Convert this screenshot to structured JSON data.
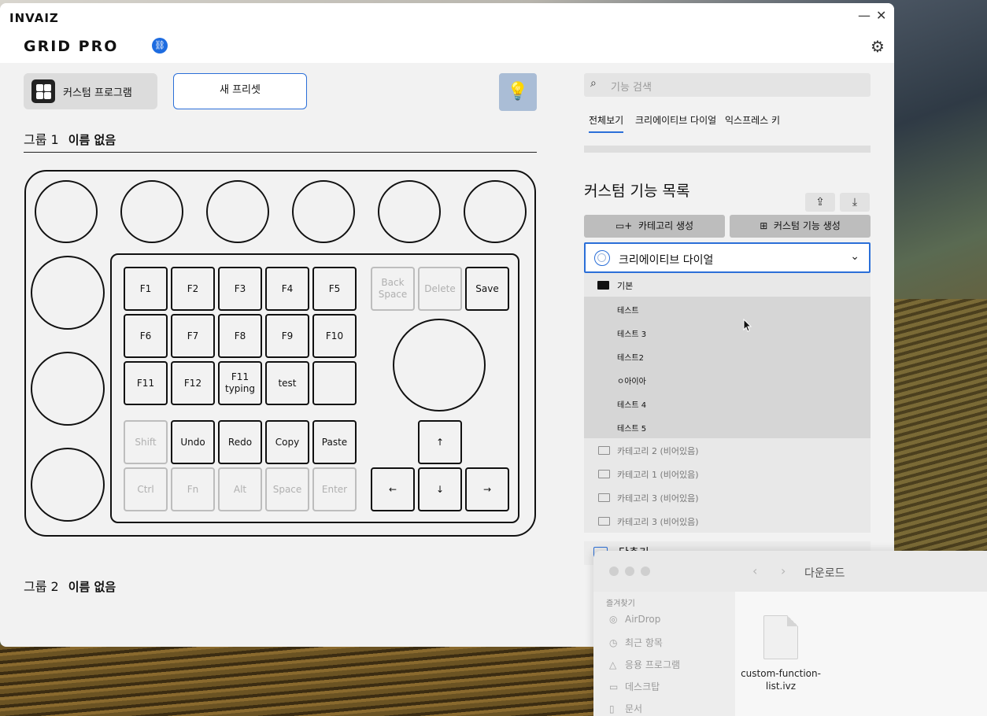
{
  "app": {
    "brand": "INVAIZ",
    "product": "GRID PRO",
    "minimize": "—",
    "close": "✕",
    "custom_program_label": "커스텀 프로그램",
    "new_preset_label": "새 프리셋",
    "group1": {
      "title": "그룹 1",
      "name": "이름 없음"
    },
    "group2": {
      "title": "그룹 2",
      "name": "이름 없음"
    }
  },
  "device": {
    "keys_row1": [
      "F1",
      "F2",
      "F3",
      "F4",
      "F5"
    ],
    "keys_row2": [
      "F6",
      "F7",
      "F8",
      "F9",
      "F10"
    ],
    "keys_row3": [
      "F11",
      "F12",
      "F11\ntyping",
      "test",
      ""
    ],
    "keys_row4": [
      "Shift",
      "Undo",
      "Redo",
      "Copy",
      "Paste"
    ],
    "keys_row5": [
      "Ctrl",
      "Fn",
      "Alt",
      "Space",
      "Enter"
    ],
    "top_right_keys": [
      "Back\nSpace",
      "Delete",
      "Save"
    ],
    "arrow_up": "↑",
    "arrows_bottom": [
      "←",
      "↓",
      "→"
    ]
  },
  "panel": {
    "search_placeholder": "기능 검색",
    "tabs": [
      "전체보기",
      "크리에이티브 다이얼",
      "익스프레스 키"
    ],
    "section_title": "커스텀 기능 목록",
    "create_category": "카테고리 생성",
    "create_function": "커스텀 기능 생성",
    "category_selected": "크리에이티브 다이얼",
    "folder_basic": "기본",
    "functions": [
      "테스트",
      "테스트 3",
      "테스트2",
      "ㅇ아이아",
      "테스트 4",
      "테스트 5"
    ],
    "empty_categories": [
      "카테고리 2 (비어있음)",
      "카테고리 1 (비어있음)",
      "카테고리 3 (비어있음)",
      "카테고리 3 (비어있음)"
    ],
    "next_category": "단축키"
  },
  "finder": {
    "title": "다운로드",
    "favorites_label": "즐겨찾기",
    "sidebar": [
      "AirDrop",
      "최근 항목",
      "응용 프로그램",
      "데스크탑",
      "문서"
    ],
    "file_name": "custom-function-list.ivz"
  }
}
